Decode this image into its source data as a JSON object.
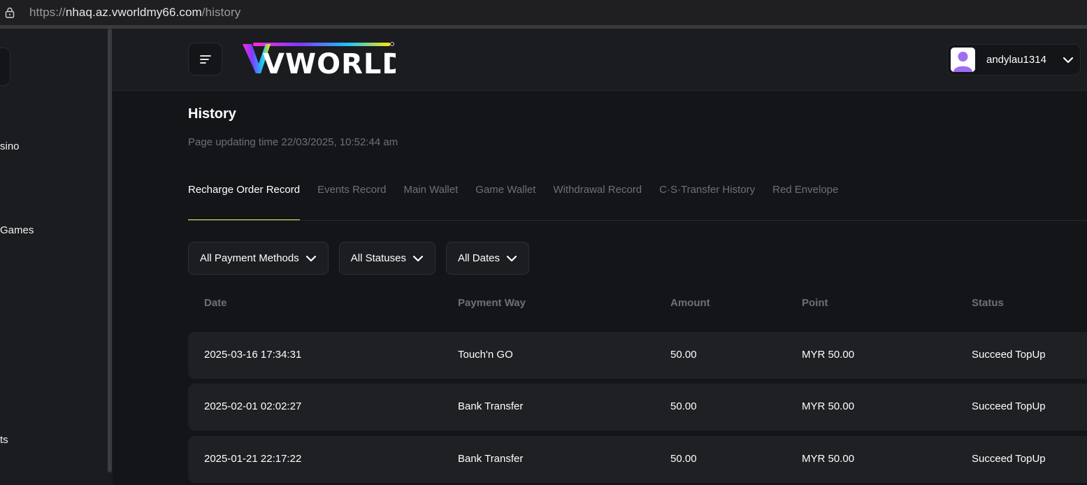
{
  "browser": {
    "url_scheme": "https://",
    "url_host": "nhaq.az.vworldmy66.com",
    "url_path": "/history"
  },
  "sidebar": {
    "items": [
      {
        "label": "sino"
      },
      {
        "label": "Games"
      },
      {
        "label": "ts"
      }
    ]
  },
  "header": {
    "logo_text": "VWORLD",
    "username": "andylau1314"
  },
  "page": {
    "title": "History",
    "updated_label": "Page updating time 22/03/2025, 10:52:44 am"
  },
  "tabs": [
    {
      "label": "Recharge Order Record",
      "active": true
    },
    {
      "label": "Events Record",
      "active": false
    },
    {
      "label": "Main Wallet",
      "active": false
    },
    {
      "label": "Game Wallet",
      "active": false
    },
    {
      "label": "Withdrawal Record",
      "active": false
    },
    {
      "label": "C·S·Transfer History",
      "active": false
    },
    {
      "label": "Red Envelope",
      "active": false
    }
  ],
  "filters": [
    {
      "label": "All Payment Methods"
    },
    {
      "label": "All Statuses"
    },
    {
      "label": "All Dates"
    }
  ],
  "table": {
    "columns": [
      "Date",
      "Payment Way",
      "Amount",
      "Point",
      "Status"
    ],
    "rows": [
      [
        "2025-03-16 17:34:31",
        "Touch'n GO",
        "50.00",
        "MYR 50.00",
        "Succeed TopUp"
      ],
      [
        "2025-02-01 02:02:27",
        "Bank Transfer",
        "50.00",
        "MYR 50.00",
        "Succeed TopUp"
      ],
      [
        "2025-01-21 22:17:22",
        "Bank Transfer",
        "50.00",
        "MYR 50.00",
        "Succeed TopUp"
      ]
    ]
  },
  "colors": {
    "accent": "#e6f06a",
    "background": "#141518",
    "surface": "#1b1c20",
    "row": "#1f2024",
    "muted_text": "#6f7075"
  },
  "icons": {
    "lock": "lock-icon",
    "menu": "menu-icon",
    "avatar": "user-avatar-icon",
    "dropdown": "chevron-down-icon"
  }
}
